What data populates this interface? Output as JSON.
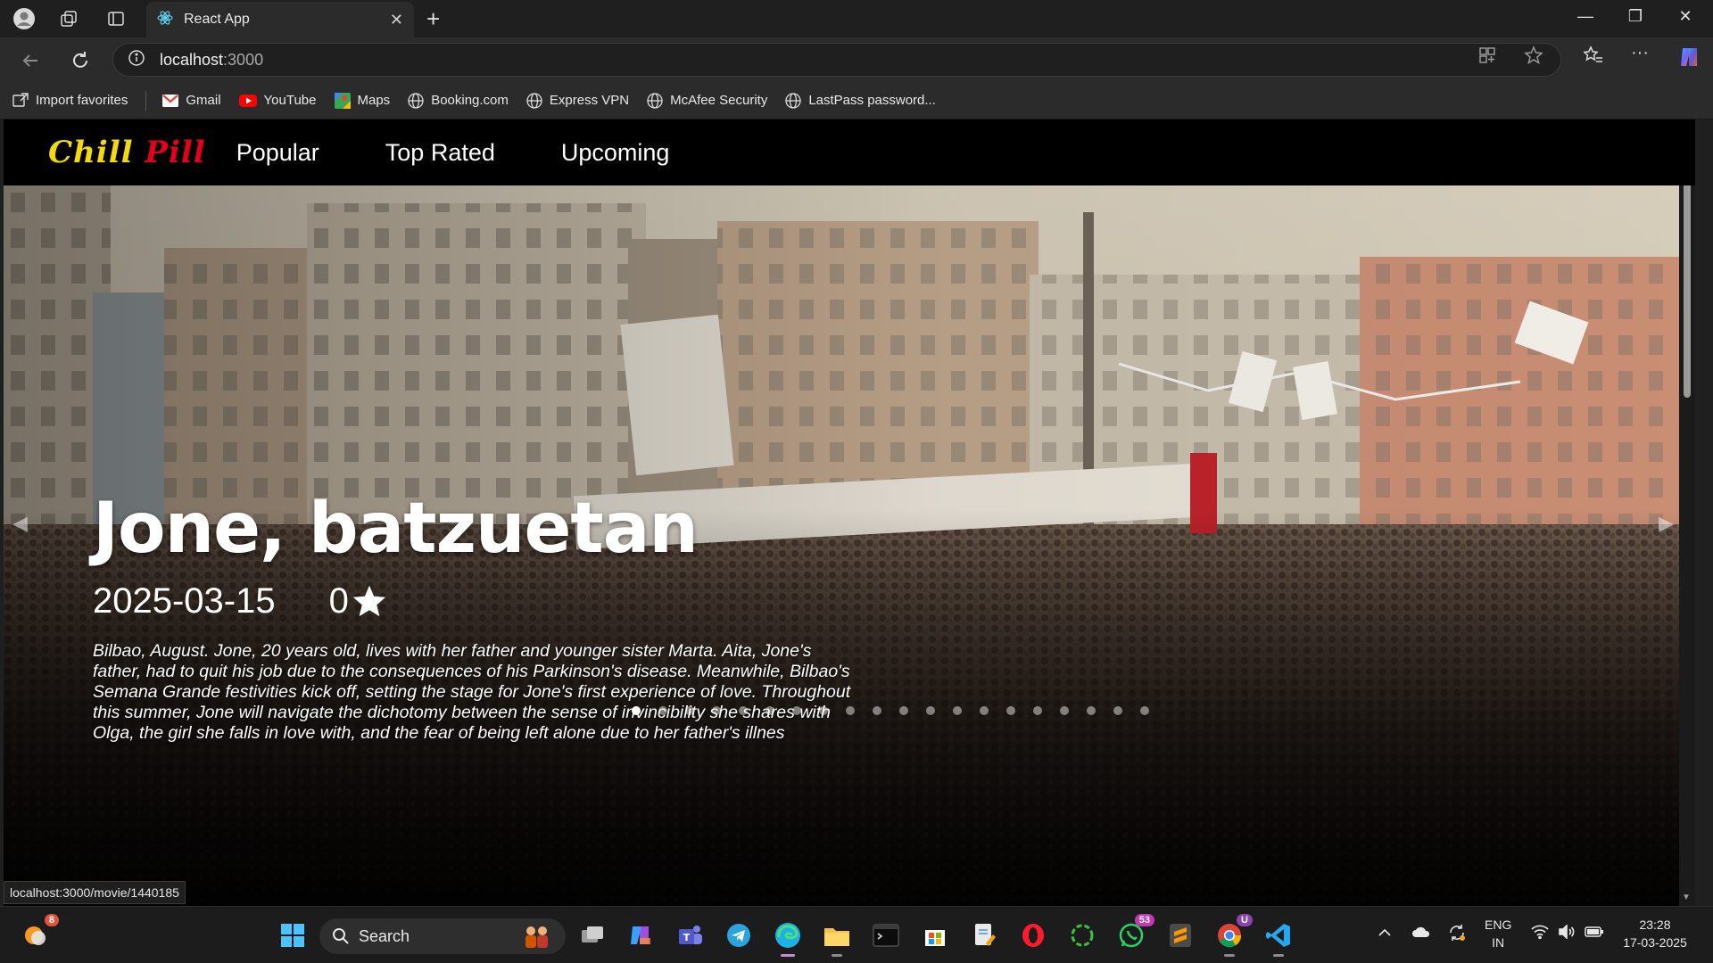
{
  "browser": {
    "tab_title": "React App",
    "url_host": "localhost",
    "url_port": ":3000",
    "status_url": "localhost:3000/movie/1440185",
    "bookmarks": [
      {
        "label": "Import favorites",
        "icon": "import-icon"
      },
      {
        "label": "Gmail",
        "icon": "gmail-icon"
      },
      {
        "label": "YouTube",
        "icon": "youtube-icon"
      },
      {
        "label": "Maps",
        "icon": "maps-icon"
      },
      {
        "label": "Booking.com",
        "icon": "globe-icon"
      },
      {
        "label": "Express VPN",
        "icon": "globe-icon"
      },
      {
        "label": "McAfee Security",
        "icon": "globe-icon"
      },
      {
        "label": "LastPass password...",
        "icon": "globe-icon"
      }
    ]
  },
  "app": {
    "logo_part1": "Chill",
    "logo_part2": "Pill",
    "nav": [
      "Popular",
      "Top Rated",
      "Upcoming"
    ]
  },
  "hero": {
    "title": "Jone, batzuetan",
    "release_date": "2025-03-15",
    "rating": "0",
    "overview": "Bilbao, August. Jone, 20 years old, lives with her father and younger sister Marta. Aita, Jone's father, had to quit his job due to the consequences of his Parkinson's disease. Meanwhile, Bilbao's Semana Grande festivities kick off, setting the stage for Jone's first experience of love. Throughout this summer, Jone will navigate the dichotomy between the sense of invincibility she shares with Olga, the girl she falls in love with, and the fear of being left alone due to her father's illnes",
    "slide_count": 20,
    "active_slide": 1
  },
  "taskbar": {
    "search_placeholder": "Search",
    "weather_badge": "8",
    "teams_badge": "",
    "whatsapp_badge": "53",
    "chrome_badge": "U",
    "lang_line1": "ENG",
    "lang_line2": "IN",
    "time": "23:28",
    "date": "17-03-2025"
  },
  "colors": {
    "logo_yellow": "#f5d90a",
    "logo_red": "#e3001b",
    "chrome_bg": "#1f1f1f",
    "toolbar_bg": "#2b2b2b"
  }
}
